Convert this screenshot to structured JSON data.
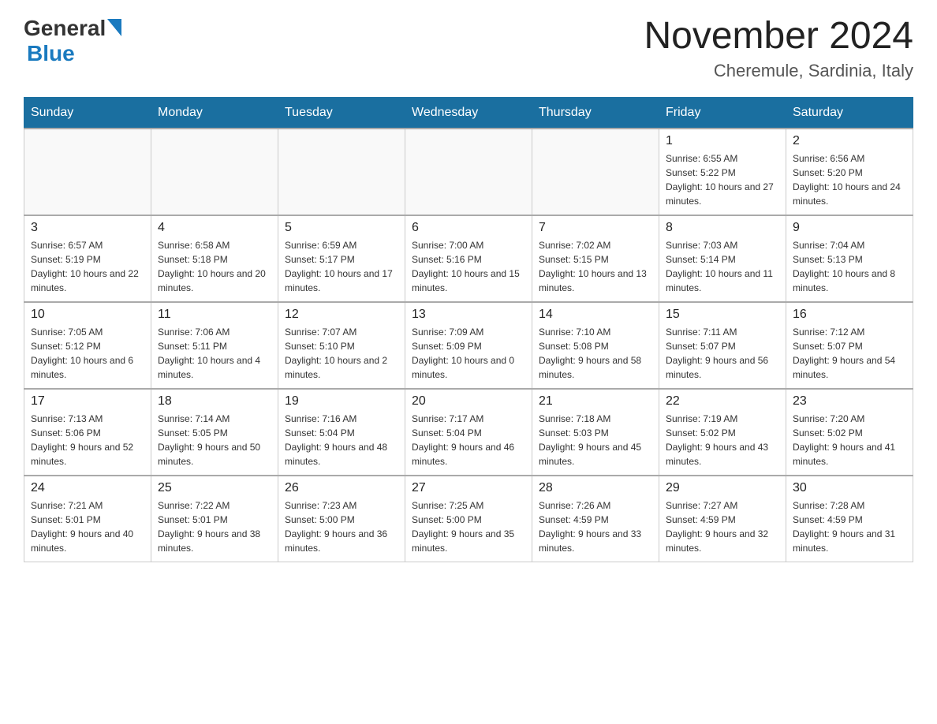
{
  "header": {
    "logo_general": "General",
    "logo_blue": "Blue",
    "month_title": "November 2024",
    "location": "Cheremule, Sardinia, Italy"
  },
  "weekdays": [
    "Sunday",
    "Monday",
    "Tuesday",
    "Wednesday",
    "Thursday",
    "Friday",
    "Saturday"
  ],
  "weeks": [
    [
      {
        "day": "",
        "sunrise": "",
        "sunset": "",
        "daylight": ""
      },
      {
        "day": "",
        "sunrise": "",
        "sunset": "",
        "daylight": ""
      },
      {
        "day": "",
        "sunrise": "",
        "sunset": "",
        "daylight": ""
      },
      {
        "day": "",
        "sunrise": "",
        "sunset": "",
        "daylight": ""
      },
      {
        "day": "",
        "sunrise": "",
        "sunset": "",
        "daylight": ""
      },
      {
        "day": "1",
        "sunrise": "Sunrise: 6:55 AM",
        "sunset": "Sunset: 5:22 PM",
        "daylight": "Daylight: 10 hours and 27 minutes."
      },
      {
        "day": "2",
        "sunrise": "Sunrise: 6:56 AM",
        "sunset": "Sunset: 5:20 PM",
        "daylight": "Daylight: 10 hours and 24 minutes."
      }
    ],
    [
      {
        "day": "3",
        "sunrise": "Sunrise: 6:57 AM",
        "sunset": "Sunset: 5:19 PM",
        "daylight": "Daylight: 10 hours and 22 minutes."
      },
      {
        "day": "4",
        "sunrise": "Sunrise: 6:58 AM",
        "sunset": "Sunset: 5:18 PM",
        "daylight": "Daylight: 10 hours and 20 minutes."
      },
      {
        "day": "5",
        "sunrise": "Sunrise: 6:59 AM",
        "sunset": "Sunset: 5:17 PM",
        "daylight": "Daylight: 10 hours and 17 minutes."
      },
      {
        "day": "6",
        "sunrise": "Sunrise: 7:00 AM",
        "sunset": "Sunset: 5:16 PM",
        "daylight": "Daylight: 10 hours and 15 minutes."
      },
      {
        "day": "7",
        "sunrise": "Sunrise: 7:02 AM",
        "sunset": "Sunset: 5:15 PM",
        "daylight": "Daylight: 10 hours and 13 minutes."
      },
      {
        "day": "8",
        "sunrise": "Sunrise: 7:03 AM",
        "sunset": "Sunset: 5:14 PM",
        "daylight": "Daylight: 10 hours and 11 minutes."
      },
      {
        "day": "9",
        "sunrise": "Sunrise: 7:04 AM",
        "sunset": "Sunset: 5:13 PM",
        "daylight": "Daylight: 10 hours and 8 minutes."
      }
    ],
    [
      {
        "day": "10",
        "sunrise": "Sunrise: 7:05 AM",
        "sunset": "Sunset: 5:12 PM",
        "daylight": "Daylight: 10 hours and 6 minutes."
      },
      {
        "day": "11",
        "sunrise": "Sunrise: 7:06 AM",
        "sunset": "Sunset: 5:11 PM",
        "daylight": "Daylight: 10 hours and 4 minutes."
      },
      {
        "day": "12",
        "sunrise": "Sunrise: 7:07 AM",
        "sunset": "Sunset: 5:10 PM",
        "daylight": "Daylight: 10 hours and 2 minutes."
      },
      {
        "day": "13",
        "sunrise": "Sunrise: 7:09 AM",
        "sunset": "Sunset: 5:09 PM",
        "daylight": "Daylight: 10 hours and 0 minutes."
      },
      {
        "day": "14",
        "sunrise": "Sunrise: 7:10 AM",
        "sunset": "Sunset: 5:08 PM",
        "daylight": "Daylight: 9 hours and 58 minutes."
      },
      {
        "day": "15",
        "sunrise": "Sunrise: 7:11 AM",
        "sunset": "Sunset: 5:07 PM",
        "daylight": "Daylight: 9 hours and 56 minutes."
      },
      {
        "day": "16",
        "sunrise": "Sunrise: 7:12 AM",
        "sunset": "Sunset: 5:07 PM",
        "daylight": "Daylight: 9 hours and 54 minutes."
      }
    ],
    [
      {
        "day": "17",
        "sunrise": "Sunrise: 7:13 AM",
        "sunset": "Sunset: 5:06 PM",
        "daylight": "Daylight: 9 hours and 52 minutes."
      },
      {
        "day": "18",
        "sunrise": "Sunrise: 7:14 AM",
        "sunset": "Sunset: 5:05 PM",
        "daylight": "Daylight: 9 hours and 50 minutes."
      },
      {
        "day": "19",
        "sunrise": "Sunrise: 7:16 AM",
        "sunset": "Sunset: 5:04 PM",
        "daylight": "Daylight: 9 hours and 48 minutes."
      },
      {
        "day": "20",
        "sunrise": "Sunrise: 7:17 AM",
        "sunset": "Sunset: 5:04 PM",
        "daylight": "Daylight: 9 hours and 46 minutes."
      },
      {
        "day": "21",
        "sunrise": "Sunrise: 7:18 AM",
        "sunset": "Sunset: 5:03 PM",
        "daylight": "Daylight: 9 hours and 45 minutes."
      },
      {
        "day": "22",
        "sunrise": "Sunrise: 7:19 AM",
        "sunset": "Sunset: 5:02 PM",
        "daylight": "Daylight: 9 hours and 43 minutes."
      },
      {
        "day": "23",
        "sunrise": "Sunrise: 7:20 AM",
        "sunset": "Sunset: 5:02 PM",
        "daylight": "Daylight: 9 hours and 41 minutes."
      }
    ],
    [
      {
        "day": "24",
        "sunrise": "Sunrise: 7:21 AM",
        "sunset": "Sunset: 5:01 PM",
        "daylight": "Daylight: 9 hours and 40 minutes."
      },
      {
        "day": "25",
        "sunrise": "Sunrise: 7:22 AM",
        "sunset": "Sunset: 5:01 PM",
        "daylight": "Daylight: 9 hours and 38 minutes."
      },
      {
        "day": "26",
        "sunrise": "Sunrise: 7:23 AM",
        "sunset": "Sunset: 5:00 PM",
        "daylight": "Daylight: 9 hours and 36 minutes."
      },
      {
        "day": "27",
        "sunrise": "Sunrise: 7:25 AM",
        "sunset": "Sunset: 5:00 PM",
        "daylight": "Daylight: 9 hours and 35 minutes."
      },
      {
        "day": "28",
        "sunrise": "Sunrise: 7:26 AM",
        "sunset": "Sunset: 4:59 PM",
        "daylight": "Daylight: 9 hours and 33 minutes."
      },
      {
        "day": "29",
        "sunrise": "Sunrise: 7:27 AM",
        "sunset": "Sunset: 4:59 PM",
        "daylight": "Daylight: 9 hours and 32 minutes."
      },
      {
        "day": "30",
        "sunrise": "Sunrise: 7:28 AM",
        "sunset": "Sunset: 4:59 PM",
        "daylight": "Daylight: 9 hours and 31 minutes."
      }
    ]
  ]
}
